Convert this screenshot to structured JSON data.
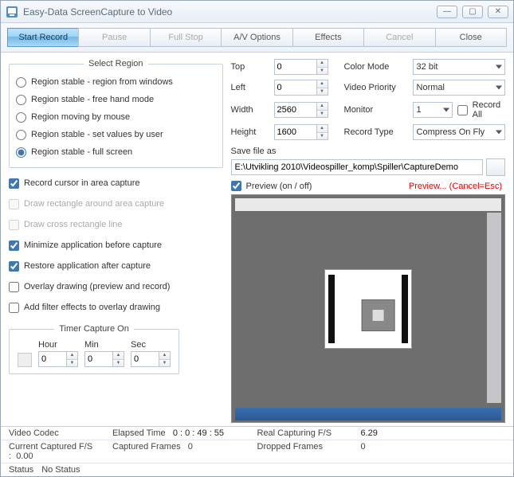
{
  "window": {
    "title": "Easy-Data ScreenCapture to Video"
  },
  "toolbar": {
    "start": "Start Record",
    "pause": "Pause",
    "fullstop": "Full Stop",
    "avoptions": "A/V Options",
    "effects": "Effects",
    "cancel": "Cancel",
    "close": "Close"
  },
  "region": {
    "legend": "Select Region",
    "opt1": "Region stable - region from windows",
    "opt2": "Region stable - free hand mode",
    "opt3": "Region moving by mouse",
    "opt4": "Region stable - set values by user",
    "opt5": "Region stable - full screen"
  },
  "checks": {
    "record_cursor": "Record cursor in area capture",
    "draw_rect": "Draw rectangle around area capture",
    "draw_cross": "Draw cross rectangle line",
    "minimize": "Minimize application before capture",
    "restore": "Restore application after capture",
    "overlay": "Overlay drawing (preview and record)",
    "filter": "Add filter effects to overlay drawing"
  },
  "timer": {
    "legend": "Timer Capture On",
    "hour_lbl": "Hour",
    "hour_val": "0",
    "min_lbl": "Min",
    "min_val": "0",
    "sec_lbl": "Sec",
    "sec_val": "0"
  },
  "coords": {
    "top_lbl": "Top",
    "top_val": "0",
    "left_lbl": "Left",
    "left_val": "0",
    "width_lbl": "Width",
    "width_val": "2560",
    "height_lbl": "Height",
    "height_val": "1600"
  },
  "settings": {
    "color_lbl": "Color Mode",
    "color_val": "32 bit",
    "priority_lbl": "Video Priority",
    "priority_val": "Normal",
    "monitor_lbl": "Monitor",
    "monitor_val": "1",
    "recordall_lbl": "Record All",
    "rectype_lbl": "Record Type",
    "rectype_val": "Compress On Fly"
  },
  "save": {
    "lbl": "Save file as",
    "path": "E:\\Utvikling 2010\\Videospiller_komp\\Spiller\\CaptureDemo"
  },
  "preview": {
    "chk_lbl": "Preview (on / off)",
    "running": "Preview... (Cancel=Esc)"
  },
  "status": {
    "codec_lbl": "Video Codec",
    "codec_val": "",
    "elapsed_lbl": "Elapsed Time",
    "elapsed_val": "0 : 0 : 49 : 55",
    "realfs_lbl": "Real Capturing F/S",
    "realfs_val": "6.29",
    "curfs_lbl": "Current Captured F/S :",
    "curfs_val": "0.00",
    "frames_lbl": "Captured Frames",
    "frames_val": "0",
    "dropped_lbl": "Dropped Frames",
    "dropped_val": "0",
    "status_lbl": "Status",
    "status_val": "No Status"
  }
}
